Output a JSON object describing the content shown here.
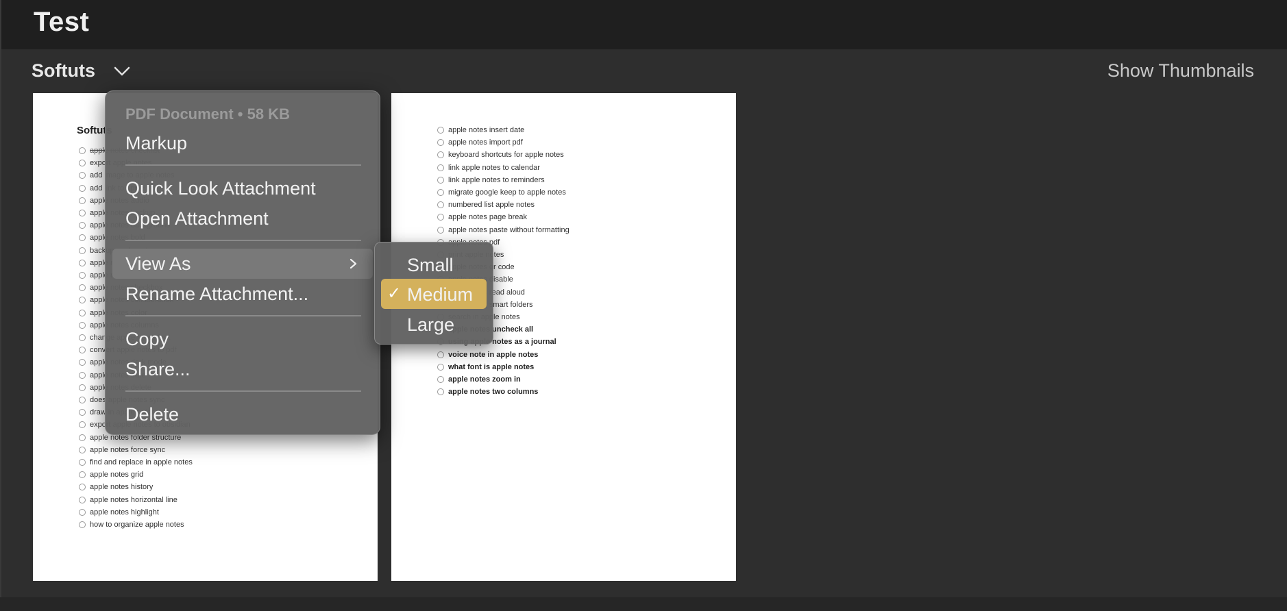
{
  "app": {
    "title": "Test"
  },
  "attachment": {
    "name": "Softuts",
    "show_thumbnails_label": "Show Thumbnails"
  },
  "page1": {
    "title": "Softuts",
    "items": [
      "apple notes checklist",
      "export apple notes",
      "add image to apple notes",
      "add link to apple notes",
      "apple notes audio",
      "apple notes backup",
      "apple notes background",
      "apple notes bold",
      "backup apple notes",
      "apple notes bullet points",
      "apple notes calendar",
      "apple notes checkbox",
      "apple notes collaboration",
      "apple notes color",
      "apple notes columns",
      "change apple notes font",
      "convert apple notes to pdf",
      "apple notes dark mode",
      "apple notes date",
      "apple notes delete",
      "does apple notes sync",
      "draw in apple notes",
      "export apple notes to obsidian",
      "apple notes folder structure",
      "apple notes force sync",
      "find and replace in apple notes",
      "apple notes grid",
      "apple notes history",
      "apple notes horizontal line",
      "apple notes highlight",
      "how to organize apple notes"
    ]
  },
  "page2": {
    "items": [
      "apple notes insert date",
      "apple notes import pdf",
      "keyboard shortcuts for apple notes",
      "link apple notes to calendar",
      "link apple notes to reminders",
      "migrate google keep to apple notes",
      "numbered list apple notes",
      "apple notes page break",
      "apple notes paste without formatting",
      "apple notes pdf",
      "print apple notes",
      "apple notes qr code",
      "apple notes disable",
      "apple notes read aloud",
      "apple notes smart folders",
      "search in apple notes",
      "apple notes uncheck all",
      "using apple notes as a journal",
      "voice note in apple notes",
      "what font is apple notes",
      "apple notes zoom in",
      "apple notes two columns"
    ]
  },
  "context_menu": {
    "info": "PDF Document • 58 KB",
    "markup": "Markup",
    "quick_look": "Quick Look Attachment",
    "open": "Open Attachment",
    "view_as": "View As",
    "rename": "Rename Attachment...",
    "copy": "Copy",
    "share": "Share...",
    "delete": "Delete"
  },
  "view_as_submenu": {
    "small": "Small",
    "medium": "Medium",
    "large": "Large",
    "selected": "Medium",
    "check": "✓",
    "highlight_color": "#d4b15c"
  }
}
